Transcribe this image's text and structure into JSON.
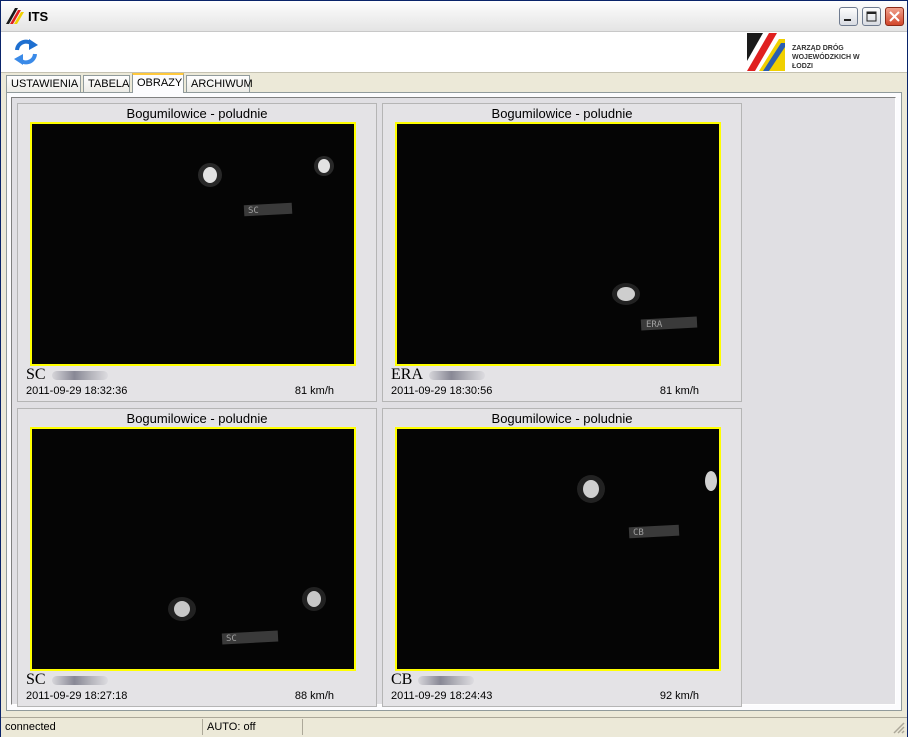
{
  "window": {
    "title": "ITS"
  },
  "toolbar": {
    "refresh_icon": "refresh-icon",
    "logo_text": "ZARZĄD DRÓG WOJEWÓDZKICH W ŁODZI"
  },
  "tabs": [
    {
      "label": "USTAWIENIA",
      "active": false
    },
    {
      "label": "TABELA",
      "active": false
    },
    {
      "label": "OBRAZY",
      "active": true
    },
    {
      "label": "ARCHIWUM",
      "active": false
    }
  ],
  "cards": [
    {
      "title": "Bogumilowice - poludnie",
      "plate": "SC",
      "timestamp": "2011-09-29 18:32:36",
      "speed": "81 km/h",
      "plate_in_image": "SC"
    },
    {
      "title": "Bogumilowice - poludnie",
      "plate": "ERA",
      "timestamp": "2011-09-29 18:30:56",
      "speed": "81 km/h",
      "plate_in_image": "ERA"
    },
    {
      "title": "Bogumilowice - poludnie",
      "plate": "SC",
      "timestamp": "2011-09-29 18:27:18",
      "speed": "88 km/h",
      "plate_in_image": "SC"
    },
    {
      "title": "Bogumilowice - poludnie",
      "plate": "CB",
      "timestamp": "2011-09-29 18:24:43",
      "speed": "92 km/h",
      "plate_in_image": "CB"
    }
  ],
  "status": {
    "connection": "connected",
    "auto": "AUTO: off"
  },
  "colors": {
    "frame_border": "#ffff00",
    "image_bg": "#050505"
  }
}
